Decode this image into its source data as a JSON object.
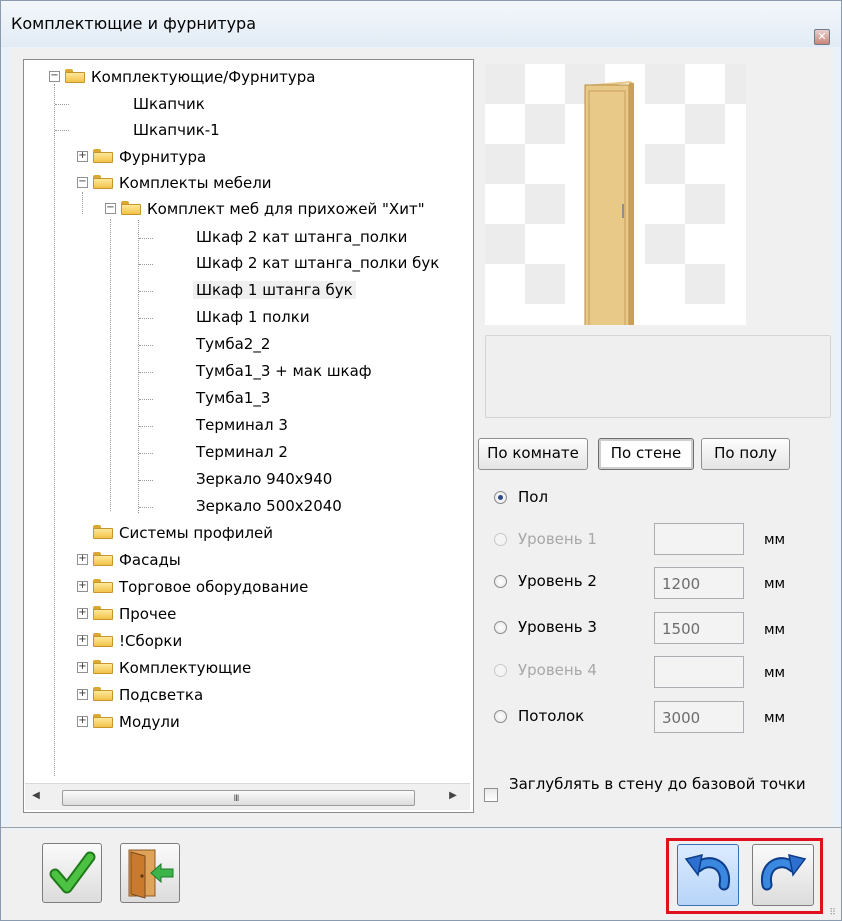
{
  "window": {
    "title": "Комплектющие и фурнитура",
    "close_glyph": "✕"
  },
  "tree": {
    "root": "Комплектующие/Фурнитура",
    "items": [
      {
        "label": "Шкапчик"
      },
      {
        "label": "Шкапчик-1"
      },
      {
        "label": "Фурнитура"
      },
      {
        "label": "Комплекты мебели"
      },
      {
        "label": "Комплект меб для прихожей \"Хит\""
      },
      {
        "label": "Шкаф 2 кат штанга_полки"
      },
      {
        "label": "Шкаф 2 кат штанга_полки бук"
      },
      {
        "label": "Шкаф 1 штанга бук"
      },
      {
        "label": "Шкаф 1 полки"
      },
      {
        "label": "Тумба2_2"
      },
      {
        "label": "Тумба1_3 + мак шкаф"
      },
      {
        "label": "Тумба1_3"
      },
      {
        "label": "Терминал 3"
      },
      {
        "label": "Терминал 2"
      },
      {
        "label": "Зеркало 940x940"
      },
      {
        "label": "Зеркало 500x2040"
      },
      {
        "label": "Системы профилей"
      },
      {
        "label": "Фасады"
      },
      {
        "label": "Торговое оборудование"
      },
      {
        "label": "Прочее"
      },
      {
        "label": "!Сборки"
      },
      {
        "label": "Комплектующие"
      },
      {
        "label": "Подсветка"
      },
      {
        "label": "Модули"
      }
    ],
    "selected": "Шкаф 1 штанга бук",
    "expander_plus": "+",
    "expander_minus": "−",
    "scroll_grip": "III",
    "scroll_left": "◀",
    "scroll_right": "▶"
  },
  "placement": {
    "tabs": [
      {
        "label": "По комнате"
      },
      {
        "label": "По стене"
      },
      {
        "label": "По полу"
      }
    ],
    "active_tab": "По стене",
    "levels": [
      {
        "label": "Пол",
        "value": "",
        "unit": "",
        "enabled": true,
        "checked": true
      },
      {
        "label": "Уровень 1",
        "value": "",
        "unit": "мм",
        "enabled": false,
        "checked": false
      },
      {
        "label": "Уровень 2",
        "value": "1200",
        "unit": "мм",
        "enabled": true,
        "checked": false
      },
      {
        "label": "Уровень 3",
        "value": "1500",
        "unit": "мм",
        "enabled": true,
        "checked": false
      },
      {
        "label": "Уровень 4",
        "value": "",
        "unit": "мм",
        "enabled": false,
        "checked": false
      },
      {
        "label": "Потолок",
        "value": "3000",
        "unit": "мм",
        "enabled": true,
        "checked": false
      }
    ],
    "deepen_checkbox_label": "Заглублять в стену до базовой точки",
    "deepen_checked": false
  },
  "footer": {
    "ok_icon": "checkmark-icon",
    "exit_icon": "exit-door-icon",
    "undo_icon": "undo-arrow-icon",
    "redo_icon": "redo-arrow-icon"
  },
  "colors": {
    "highlight": "#e0101f",
    "check_green": "#3cb035",
    "arrow_blue": "#2e6fd0"
  }
}
